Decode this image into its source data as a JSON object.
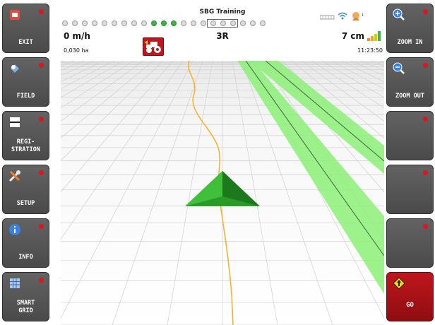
{
  "header": {
    "title": "SBG Training",
    "speed": "0 m/h",
    "area": "0,030 ha",
    "row": "3R",
    "precision": "7 cm",
    "time": "11:23:50",
    "status_dots_total": 21,
    "status_dots_active": 3
  },
  "left_menu": [
    {
      "label": "EXIT",
      "icon": "exit-icon"
    },
    {
      "label": "FIELD",
      "icon": "field-icon"
    },
    {
      "label": "REGI-\nSTRATION",
      "icon": "registration-icon"
    },
    {
      "label": "SETUP",
      "icon": "setup-tools-icon"
    },
    {
      "label": "INFO",
      "icon": "info-icon"
    },
    {
      "label": "SMART\nGRID",
      "icon": "grid-icon"
    }
  ],
  "right_menu": [
    {
      "label": "ZOOM IN",
      "icon": "zoom-in-icon"
    },
    {
      "label": "ZOOM OUT",
      "icon": "zoom-out-icon"
    },
    {
      "label": "",
      "icon": ""
    },
    {
      "label": "",
      "icon": ""
    },
    {
      "label": "",
      "icon": ""
    },
    {
      "label": "GO",
      "icon": "go-arrow-icon"
    }
  ],
  "colors": {
    "button_bg": "#555555",
    "go_button_bg": "#b01218",
    "indicator_dot": "#e0141c",
    "guidance_band": "#8cf078",
    "track_line": "#f2b42c",
    "vehicle": "#2a9a28"
  }
}
